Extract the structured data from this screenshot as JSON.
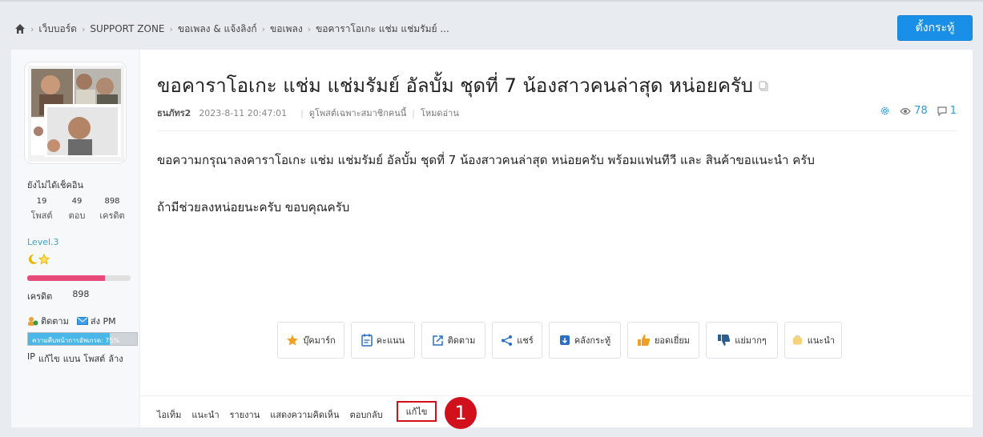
{
  "breadcrumb": {
    "items": [
      "เว็บบอร์ด",
      "SUPPORT ZONE",
      "ขอเพลง & แจ้งลิงก์",
      "ขอเพลง",
      "ขอคาราโอเกะ แช่ม แช่มรัมย์ ..."
    ]
  },
  "header": {
    "post_button": "ตั้งกระทู้"
  },
  "sidebar": {
    "status": "ยังไม่ได้เช็คอิน",
    "stats": [
      {
        "value": "19",
        "label": "โพสต์"
      },
      {
        "value": "49",
        "label": "ตอบ"
      },
      {
        "value": "898",
        "label": "เครดิต"
      }
    ],
    "level": "Level.3",
    "level_progress": 0.75,
    "credit_label": "เครดิต",
    "credit_value": "898",
    "follow_label": "ติดตาม",
    "pm_label": "ส่ง PM",
    "upgrade_text": "ความคืบหน้าการอัพเกรด: 75%",
    "upgrade_progress": 0.75,
    "admin_links": [
      "IP",
      "แก้ไข",
      "แบน",
      "โพสต์",
      "ล้าง"
    ]
  },
  "post": {
    "title": "ขอคาราโอเกะ แช่ม แช่มรัมย์ อัลบั้ม ชุดที่ 7 น้องสาวคนล่าสุด หน่อยครับ",
    "author": "ธนภัทร2",
    "date": "2023-8-11 20:47:01",
    "filter_link": "ดูโพสต์เฉพาะสมาชิกคนนี้",
    "read_mode": "โหมดอ่าน",
    "views": "78",
    "replies": "1",
    "body_line1": "ขอความกรุณาลงคาราโอเกะ แช่ม แช่มรัมย์ อัลบั้ม ชุดที่ 7 น้องสาวคนล่าสุด หน่อยครับ พร้อมแฟนทีวี และ สินค้าขอแนะนำ ครับ",
    "body_line2": "ถ้ามีช่วยลงหน่อยนะครับ ขอบคุณครับ"
  },
  "actions": [
    {
      "label": "บุ๊คมาร์ก",
      "icon": "star-icon"
    },
    {
      "label": "คะแนน",
      "icon": "rate-icon"
    },
    {
      "label": "ติดตาม",
      "icon": "follow-icon"
    },
    {
      "label": "แชร์",
      "icon": "share-icon"
    },
    {
      "label": "คลังกระทู้",
      "icon": "archive-icon"
    },
    {
      "label": "ยอดเยี่ยม",
      "icon": "thumbs-up-icon"
    },
    {
      "label": "แย่มากๆ",
      "icon": "thumbs-down-icon"
    },
    {
      "label": "แนะนำ",
      "icon": "recommend-icon"
    }
  ],
  "footer": {
    "links": [
      "ไอเท็ม",
      "แนะนำ",
      "รายงาน",
      "แสดงความคิดเห็น",
      "ตอบกลับ"
    ],
    "edit_label": "แก้ไข",
    "marker": "1"
  },
  "colors": {
    "accent": "#1a8fe8",
    "highlight_red": "#d0101a",
    "level_teal": "#3aa3c4"
  }
}
